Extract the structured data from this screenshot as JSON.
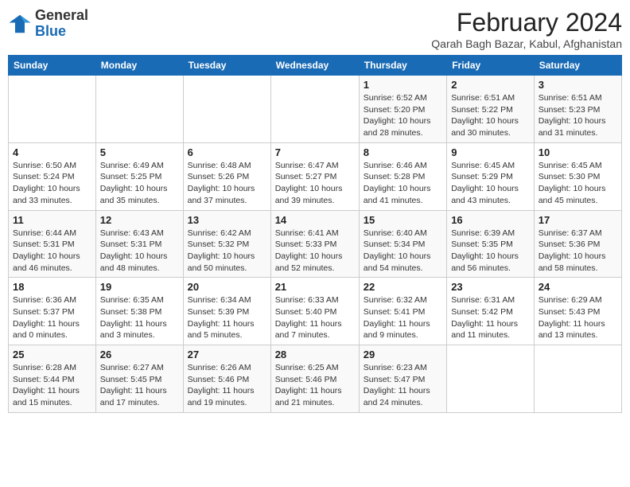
{
  "header": {
    "logo_general": "General",
    "logo_blue": "Blue",
    "title": "February 2024",
    "subtitle": "Qarah Bagh Bazar, Kabul, Afghanistan"
  },
  "days_of_week": [
    "Sunday",
    "Monday",
    "Tuesday",
    "Wednesday",
    "Thursday",
    "Friday",
    "Saturday"
  ],
  "weeks": [
    [
      {
        "day": "",
        "info": ""
      },
      {
        "day": "",
        "info": ""
      },
      {
        "day": "",
        "info": ""
      },
      {
        "day": "",
        "info": ""
      },
      {
        "day": "1",
        "info": "Sunrise: 6:52 AM\nSunset: 5:20 PM\nDaylight: 10 hours and 28 minutes."
      },
      {
        "day": "2",
        "info": "Sunrise: 6:51 AM\nSunset: 5:22 PM\nDaylight: 10 hours and 30 minutes."
      },
      {
        "day": "3",
        "info": "Sunrise: 6:51 AM\nSunset: 5:23 PM\nDaylight: 10 hours and 31 minutes."
      }
    ],
    [
      {
        "day": "4",
        "info": "Sunrise: 6:50 AM\nSunset: 5:24 PM\nDaylight: 10 hours and 33 minutes."
      },
      {
        "day": "5",
        "info": "Sunrise: 6:49 AM\nSunset: 5:25 PM\nDaylight: 10 hours and 35 minutes."
      },
      {
        "day": "6",
        "info": "Sunrise: 6:48 AM\nSunset: 5:26 PM\nDaylight: 10 hours and 37 minutes."
      },
      {
        "day": "7",
        "info": "Sunrise: 6:47 AM\nSunset: 5:27 PM\nDaylight: 10 hours and 39 minutes."
      },
      {
        "day": "8",
        "info": "Sunrise: 6:46 AM\nSunset: 5:28 PM\nDaylight: 10 hours and 41 minutes."
      },
      {
        "day": "9",
        "info": "Sunrise: 6:45 AM\nSunset: 5:29 PM\nDaylight: 10 hours and 43 minutes."
      },
      {
        "day": "10",
        "info": "Sunrise: 6:45 AM\nSunset: 5:30 PM\nDaylight: 10 hours and 45 minutes."
      }
    ],
    [
      {
        "day": "11",
        "info": "Sunrise: 6:44 AM\nSunset: 5:31 PM\nDaylight: 10 hours and 46 minutes."
      },
      {
        "day": "12",
        "info": "Sunrise: 6:43 AM\nSunset: 5:31 PM\nDaylight: 10 hours and 48 minutes."
      },
      {
        "day": "13",
        "info": "Sunrise: 6:42 AM\nSunset: 5:32 PM\nDaylight: 10 hours and 50 minutes."
      },
      {
        "day": "14",
        "info": "Sunrise: 6:41 AM\nSunset: 5:33 PM\nDaylight: 10 hours and 52 minutes."
      },
      {
        "day": "15",
        "info": "Sunrise: 6:40 AM\nSunset: 5:34 PM\nDaylight: 10 hours and 54 minutes."
      },
      {
        "day": "16",
        "info": "Sunrise: 6:39 AM\nSunset: 5:35 PM\nDaylight: 10 hours and 56 minutes."
      },
      {
        "day": "17",
        "info": "Sunrise: 6:37 AM\nSunset: 5:36 PM\nDaylight: 10 hours and 58 minutes."
      }
    ],
    [
      {
        "day": "18",
        "info": "Sunrise: 6:36 AM\nSunset: 5:37 PM\nDaylight: 11 hours and 0 minutes."
      },
      {
        "day": "19",
        "info": "Sunrise: 6:35 AM\nSunset: 5:38 PM\nDaylight: 11 hours and 3 minutes."
      },
      {
        "day": "20",
        "info": "Sunrise: 6:34 AM\nSunset: 5:39 PM\nDaylight: 11 hours and 5 minutes."
      },
      {
        "day": "21",
        "info": "Sunrise: 6:33 AM\nSunset: 5:40 PM\nDaylight: 11 hours and 7 minutes."
      },
      {
        "day": "22",
        "info": "Sunrise: 6:32 AM\nSunset: 5:41 PM\nDaylight: 11 hours and 9 minutes."
      },
      {
        "day": "23",
        "info": "Sunrise: 6:31 AM\nSunset: 5:42 PM\nDaylight: 11 hours and 11 minutes."
      },
      {
        "day": "24",
        "info": "Sunrise: 6:29 AM\nSunset: 5:43 PM\nDaylight: 11 hours and 13 minutes."
      }
    ],
    [
      {
        "day": "25",
        "info": "Sunrise: 6:28 AM\nSunset: 5:44 PM\nDaylight: 11 hours and 15 minutes."
      },
      {
        "day": "26",
        "info": "Sunrise: 6:27 AM\nSunset: 5:45 PM\nDaylight: 11 hours and 17 minutes."
      },
      {
        "day": "27",
        "info": "Sunrise: 6:26 AM\nSunset: 5:46 PM\nDaylight: 11 hours and 19 minutes."
      },
      {
        "day": "28",
        "info": "Sunrise: 6:25 AM\nSunset: 5:46 PM\nDaylight: 11 hours and 21 minutes."
      },
      {
        "day": "29",
        "info": "Sunrise: 6:23 AM\nSunset: 5:47 PM\nDaylight: 11 hours and 24 minutes."
      },
      {
        "day": "",
        "info": ""
      },
      {
        "day": "",
        "info": ""
      }
    ]
  ]
}
